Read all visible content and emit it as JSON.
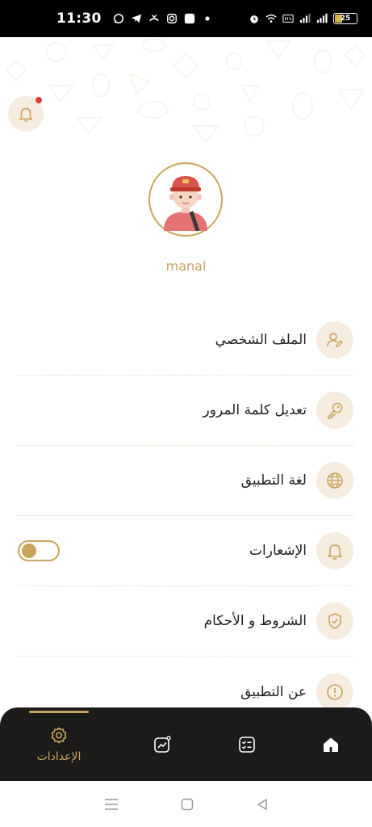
{
  "status_bar": {
    "time": "11:30",
    "battery": "25",
    "icons": [
      "whatsapp-icon",
      "telegram-icon",
      "missed-call-icon",
      "instagram-icon",
      "app-icon",
      "dot-icon",
      "alarm-icon",
      "wifi-icon",
      "volte-icon",
      "signal-icon",
      "signal-icon-2"
    ]
  },
  "header": {
    "has_notification": true
  },
  "profile": {
    "username": "manal"
  },
  "menu": {
    "items": [
      {
        "label": "الملف الشخصي",
        "icon": "user-edit-icon"
      },
      {
        "label": "تعديل كلمة المرور",
        "icon": "key-icon"
      },
      {
        "label": "لغة التطبيق",
        "icon": "globe-icon"
      },
      {
        "label": "الإشعارات",
        "icon": "bell-icon",
        "toggle": true,
        "toggle_on": false
      },
      {
        "label": "الشروط و الأحكام",
        "icon": "shield-check-icon"
      },
      {
        "label": "عن التطبيق",
        "icon": "info-icon"
      }
    ]
  },
  "bottom_nav": {
    "settings_label": "الإعدادات",
    "items": [
      "settings-icon",
      "chart-icon",
      "checklist-icon",
      "home-icon"
    ]
  },
  "colors": {
    "accent": "#c9a45c",
    "icon_bg": "#f6ece0",
    "nav_bg": "#1c1b19"
  }
}
